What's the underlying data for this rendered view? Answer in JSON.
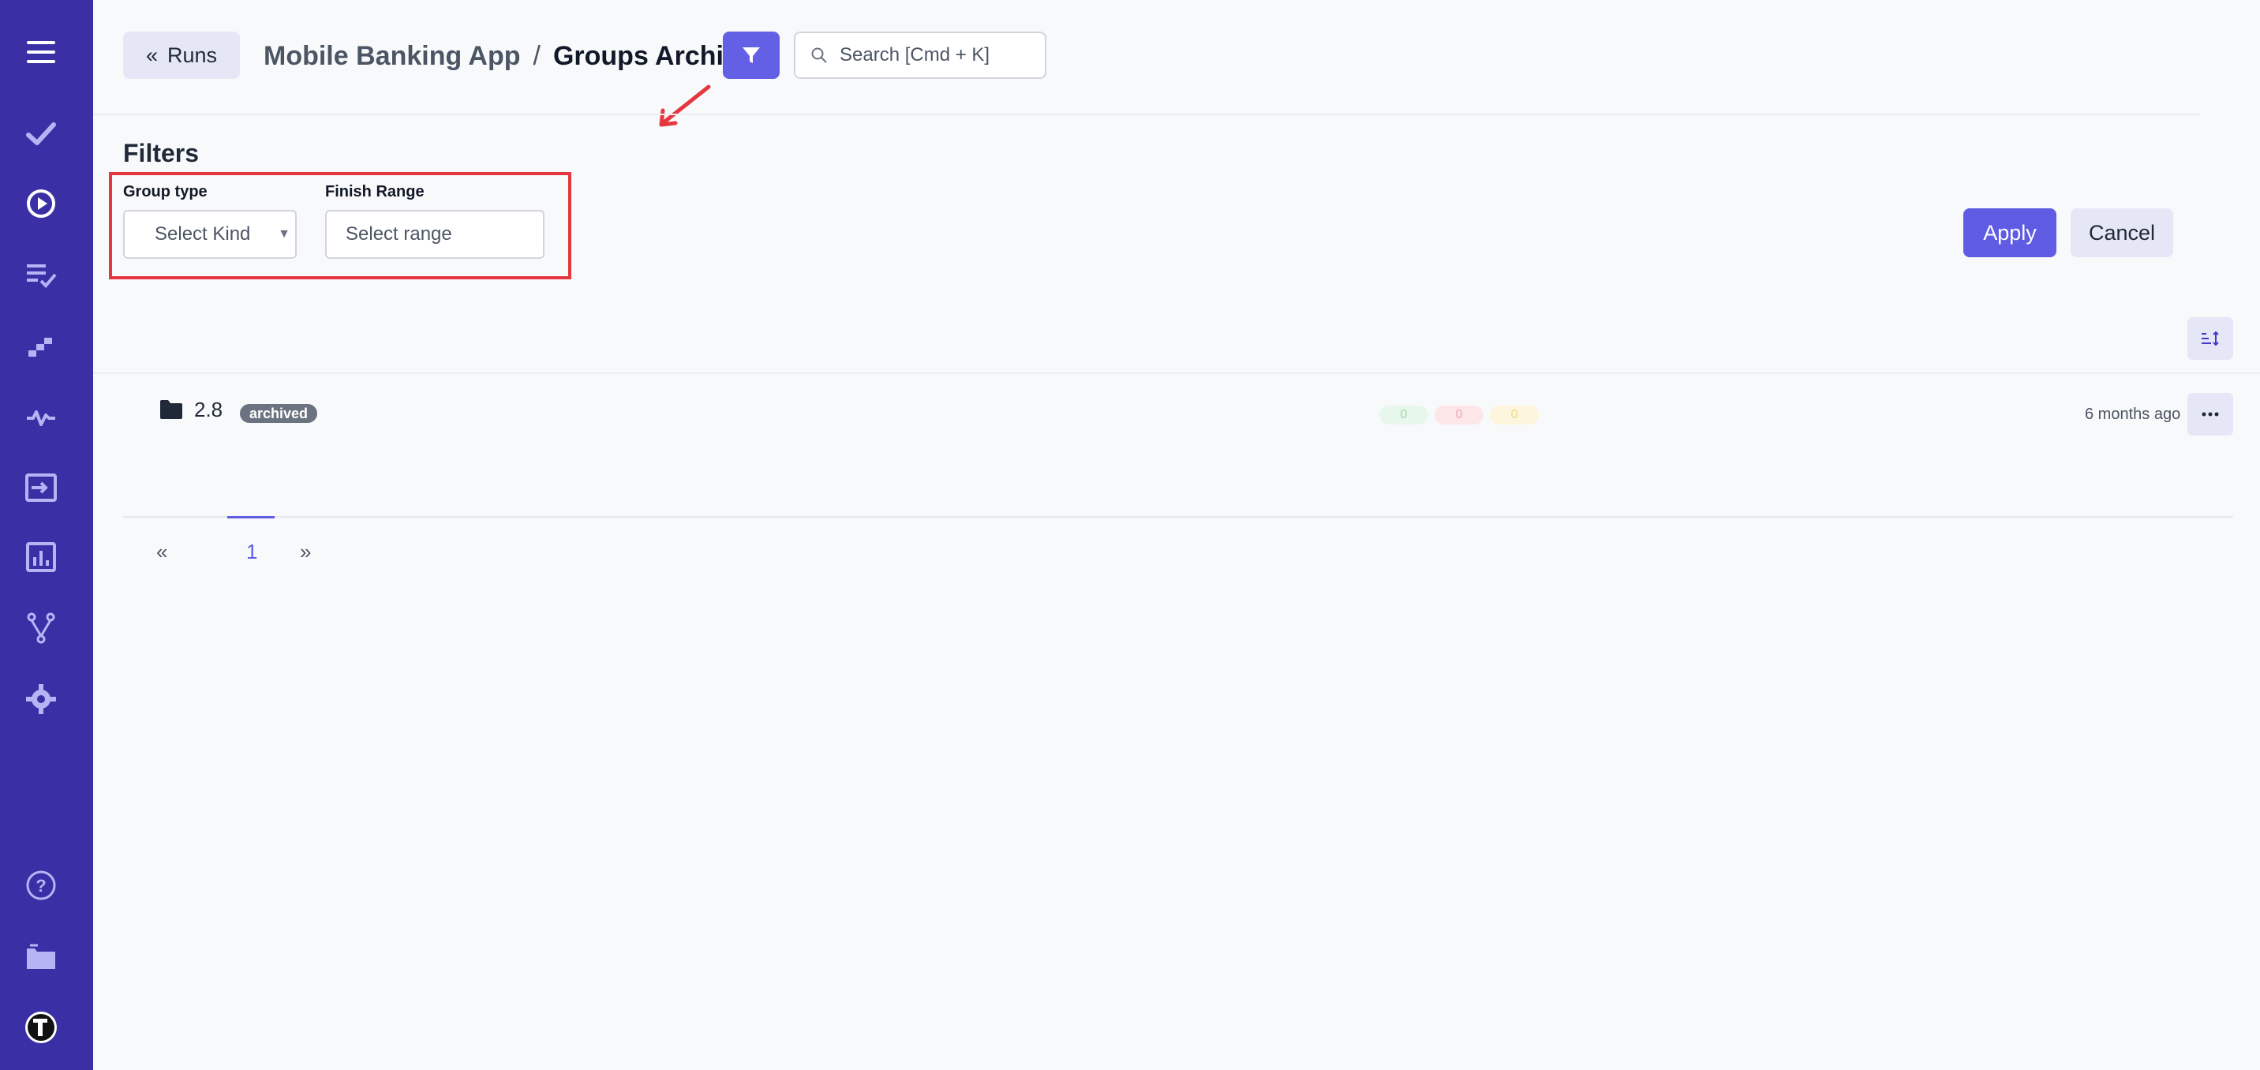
{
  "sidebar": {
    "items": [
      {
        "icon": "menu-icon"
      },
      {
        "icon": "check-icon"
      },
      {
        "icon": "play-circle-icon"
      },
      {
        "icon": "list-check-icon"
      },
      {
        "icon": "steps-icon"
      },
      {
        "icon": "pulse-icon"
      },
      {
        "icon": "import-icon"
      },
      {
        "icon": "analytics-icon"
      },
      {
        "icon": "branch-icon"
      },
      {
        "icon": "settings-icon"
      },
      {
        "icon": "help-icon"
      },
      {
        "icon": "projects-icon"
      },
      {
        "icon": "logo-icon"
      }
    ],
    "background": "#3a2fa4"
  },
  "header": {
    "back_label": "Runs",
    "project": "Mobile Banking App",
    "separator": "/",
    "current": "Groups Archive",
    "search_placeholder": "Search [Cmd + K]"
  },
  "filters": {
    "title": "Filters",
    "group_type_label": "Group type",
    "group_type_value": "Select Kind",
    "finish_range_label": "Finish Range",
    "finish_range_placeholder": "Select range",
    "apply_label": "Apply",
    "cancel_label": "Cancel"
  },
  "list": {
    "rows": [
      {
        "name": "2.8",
        "badge": "archived",
        "passed": "0",
        "failed": "0",
        "skipped": "0",
        "time": "6 months ago"
      }
    ]
  },
  "pagination": {
    "prev": "«",
    "current": "1",
    "next": "»"
  },
  "colors": {
    "accent": "#5f5ce3",
    "annotation": "#e5373f"
  }
}
